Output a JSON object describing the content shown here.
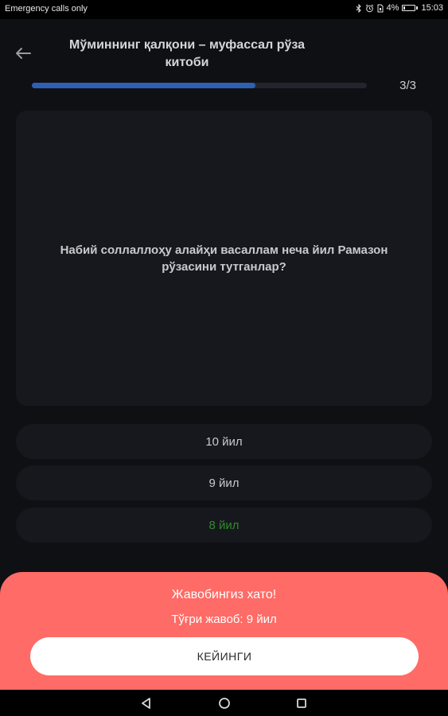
{
  "status_bar": {
    "carrier_text": "Emergency calls only",
    "battery_percent": "4%",
    "time": "15:03",
    "icons": [
      "bluetooth-icon",
      "alarm-icon",
      "sim-icon",
      "battery-icon"
    ]
  },
  "header": {
    "title": "Мўминнинг қалқони – муфассал рўза китоби",
    "progress_fraction": 0.667,
    "progress_text": "3/3"
  },
  "question": {
    "text": "Набий соллаллоҳу алайҳи васаллам неча йил Рамазон рўзасини тутганлар?"
  },
  "options": [
    {
      "label": "10 йил",
      "state": "default"
    },
    {
      "label": "9 йил",
      "state": "default"
    },
    {
      "label": "8 йил",
      "state": "selected-wrong"
    }
  ],
  "result": {
    "title": "Жавобингиз хато!",
    "correct_answer": "Тўғри жавоб: 9 йил",
    "next_button_label": "КЕЙИНГИ"
  },
  "colors": {
    "background": "#0f1014",
    "card": "#17181d",
    "progress_accent": "#2f5fb3",
    "result_sheet": "#ff6b66",
    "selected_option_text": "#2e8b2e"
  },
  "nav_bar": {
    "icons": [
      "back-triangle-icon",
      "home-circle-icon",
      "recents-square-icon"
    ]
  }
}
